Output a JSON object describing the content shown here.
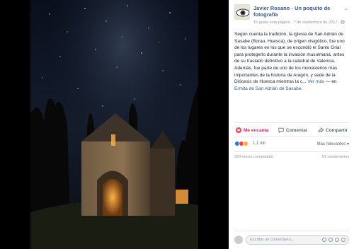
{
  "post": {
    "page_name": "Javier Rosano - Un poquito de fotografía",
    "meta": "Te gusta esta página · 7 de septiembre de 2017 · ",
    "text_main": "Según cuenta la tradición, la iglesia de San Adrián de Sasabe (Borau, Huesca), de origen visigótico, fue uno de los lugares en los que se escondió el Santo Grial para protegerlo durante la invasión musulmana, antes de su traslado definitivo a la catedral de Valencia. Además, fue parte de uno de los monasterios más importantes de la historia de Aragón, y sede de la Diócesis de Huesca mientras la c...",
    "see_more": "Ver más",
    "separator": " — en ",
    "place_link": "Ermita de San Adrián de Sasabe",
    "place_end": "."
  },
  "actions": {
    "like": "Me encanta",
    "comment": "Comentar",
    "share": "Compartir"
  },
  "reactions": {
    "count": "1,1 mil",
    "relevance": "Más relevantes ▾",
    "colors": [
      "#1877f2",
      "#f33e58",
      "#f7b125"
    ]
  },
  "stats": {
    "shares": "329 veces compartido",
    "comments": "51 comentarios"
  },
  "comment_input": {
    "placeholder": "Escribe un comentario..."
  },
  "icons": {
    "chevron": "chevron-down-icon",
    "like": "heart-icon",
    "comment": "comment-icon",
    "share": "share-icon"
  }
}
